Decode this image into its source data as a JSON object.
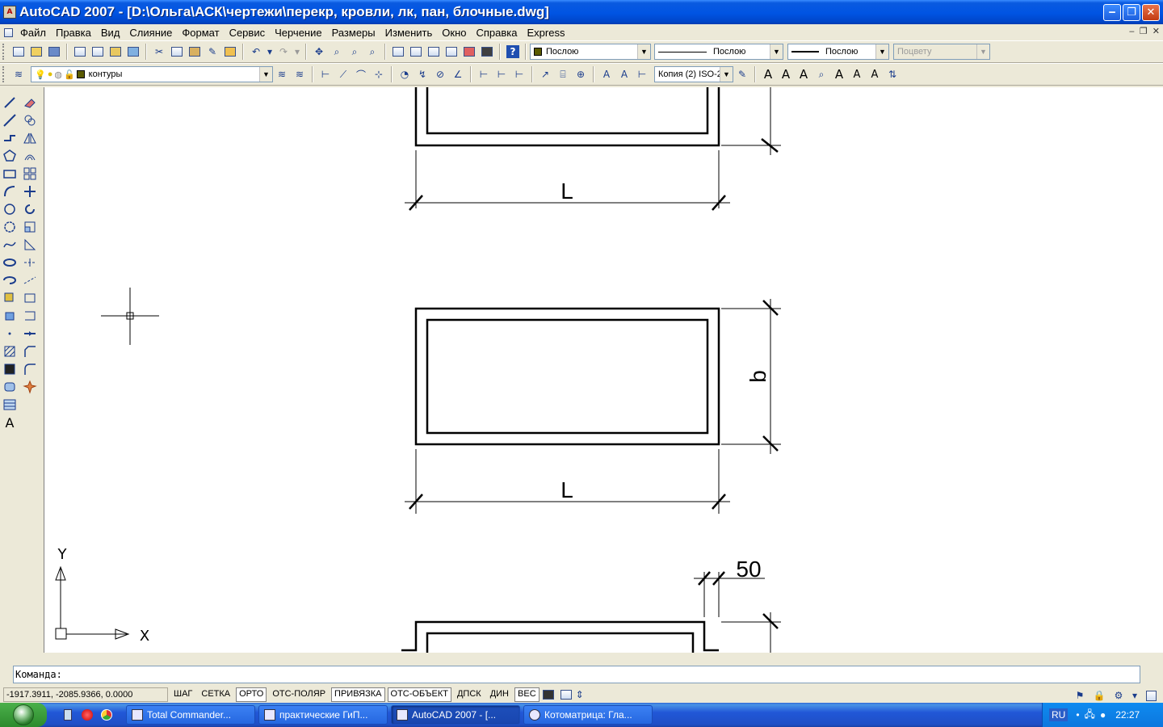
{
  "window": {
    "title": "AutoCAD 2007 - [D:\\Ольга\\АСК\\чертежи\\перекр, кровли, лк, пан, блочные.dwg]",
    "min_label": "‒",
    "max_label": "❐",
    "close_label": "✕"
  },
  "menu": {
    "items": [
      "Файл",
      "Правка",
      "Вид",
      "Слияние",
      "Формат",
      "Сервис",
      "Черчение",
      "Размеры",
      "Изменить",
      "Окно",
      "Справка",
      "Express"
    ]
  },
  "properties": {
    "color": "Послою",
    "linetype": "Послою",
    "lineweight": "Послою",
    "plotstyle": "Поцвету"
  },
  "layers": {
    "current_layer": "контуры"
  },
  "dimstyle": {
    "current": "Копия (2) ISO-2"
  },
  "drawing": {
    "dim_L_top": "L",
    "dim_L_middle": "L",
    "dim_b": "b",
    "dim_50": "50",
    "ucs_x": "X",
    "ucs_y": "Y"
  },
  "command": {
    "prompt": "Команда:"
  },
  "status": {
    "coords": "-1917.3911, -2085.9366, 0.0000",
    "toggles": [
      {
        "label": "ШАГ",
        "on": false
      },
      {
        "label": "СЕТКА",
        "on": false
      },
      {
        "label": "ОРТО",
        "on": true
      },
      {
        "label": "ОТС-ПОЛЯР",
        "on": false
      },
      {
        "label": "ПРИВЯЗКА",
        "on": true
      },
      {
        "label": "ОТС-ОБЪЕКТ",
        "on": true
      },
      {
        "label": "ДПСК",
        "on": false
      },
      {
        "label": "ДИН",
        "on": false
      },
      {
        "label": "ВЕС",
        "on": true
      }
    ]
  },
  "taskbar": {
    "tasks": [
      {
        "label": "Total Commander...",
        "active": false
      },
      {
        "label": "практические ГиП...",
        "active": false
      },
      {
        "label": "AutoCAD 2007 - [...",
        "active": true
      },
      {
        "label": "Котоматрица: Гла...",
        "active": false
      }
    ],
    "lang": "RU",
    "clock": "22:27"
  },
  "colors": {
    "titlebar": "#0054e3",
    "taskbar": "#245edb",
    "chrome": "#ece9d8",
    "canvas": "#ffffff",
    "layer_swatch": "#5a5a00"
  }
}
